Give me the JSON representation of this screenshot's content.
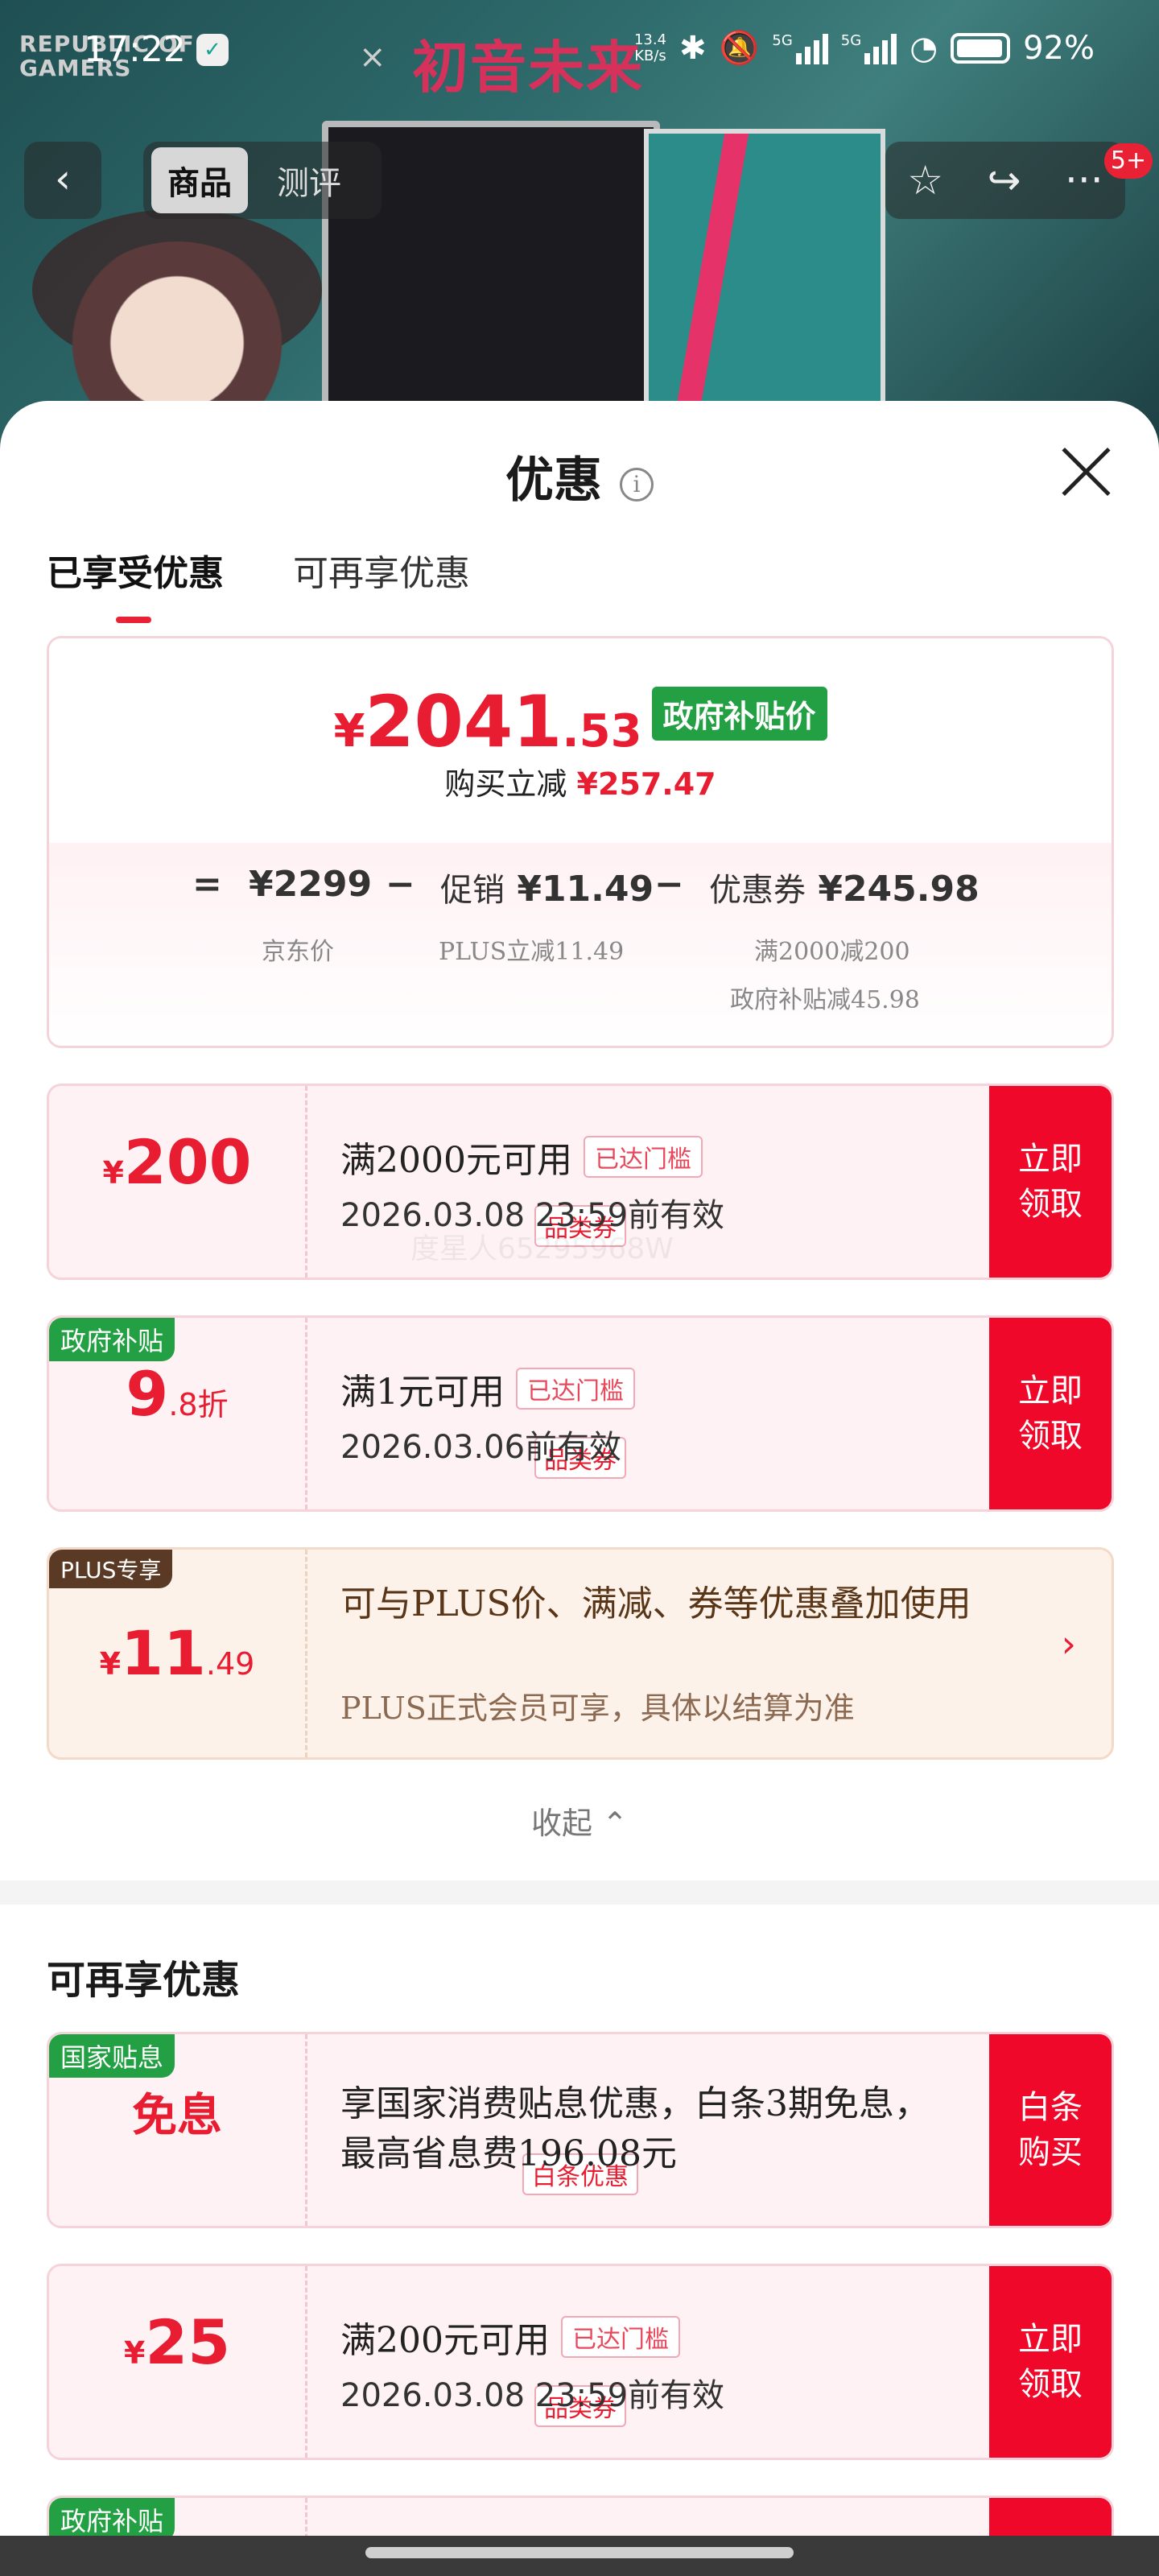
{
  "status_bar": {
    "time": "17:22",
    "net_speed": "13.4\nKB/s",
    "net_speed_value": "13.4",
    "net_speed_unit": "KB/s",
    "signal1": "5G",
    "signal2": "5G",
    "battery": "92%"
  },
  "banner": {
    "brand_left": "REPUBLIC OF\nGAMERS",
    "brand_line1": "REPUBLIC OF",
    "brand_line2": "GAMERS",
    "brand_x": "×",
    "brand_right": "初音未来"
  },
  "nav": {
    "back": "‹",
    "tabs": [
      {
        "label": "商品",
        "active": true
      },
      {
        "label": "测评",
        "active": false
      }
    ],
    "star": "☆",
    "share": "↪",
    "more": "···",
    "badge": "5+"
  },
  "sheet": {
    "title": "优惠",
    "info": "i",
    "tabs": [
      {
        "label": "已享受优惠",
        "active": true
      },
      {
        "label": "可再享优惠",
        "active": false
      }
    ]
  },
  "summary": {
    "yen": "¥",
    "price_int": "2041",
    "price_dec": ".53",
    "gov_tag": "政府补贴价",
    "reduce_label": "购买立减",
    "reduce_value": "¥257.47",
    "equals": "=",
    "jd_price": "¥2299",
    "minus": "−",
    "promo_label": "促销",
    "promo_value": "¥11.49",
    "coupon_label": "优惠券",
    "coupon_value": "¥245.98",
    "jd_sub": "京东价",
    "promo_sub": "PLUS立减11.49",
    "coupon_sub1": "满2000减200",
    "coupon_sub2": "政府补贴减45.98"
  },
  "coupons": [
    {
      "yen": "¥",
      "big": "200",
      "small": "",
      "kind": "品类券",
      "condition": "满2000元可用",
      "tag": "已达门槛",
      "valid": "2026.03.08 23:59前有效",
      "action_line1": "立即",
      "action_line2": "领取"
    },
    {
      "corner": "政府补贴",
      "big": "9",
      "small": ".8折",
      "kind": "品类券",
      "condition": "满1元可用",
      "tag": "已达门槛",
      "valid": "2026.03.06前有效",
      "action_line1": "立即",
      "action_line2": "领取"
    }
  ],
  "plus": {
    "corner": "PLUS专享",
    "yen": "¥",
    "big": "11",
    "small": ".49",
    "desc1": "可与PLUS价、满减、券等优惠叠加使用",
    "desc2": "PLUS正式会员可享，具体以结算为准",
    "chevron": "›"
  },
  "collapse_label": "收起 ⌃",
  "watermark": "度星人65295968W",
  "more_section": {
    "title": "可再享优惠",
    "free": {
      "corner": "国家贴息",
      "big": "免息",
      "kind": "白条优惠",
      "desc": "享国家消费贴息优惠，白条3期免息，最高省息费196.08元",
      "action_line1": "白条",
      "action_line2": "购买"
    },
    "coupon": {
      "yen": "¥",
      "big": "25",
      "kind": "品类券",
      "condition": "满200元可用",
      "tag": "已达门槛",
      "valid": "2026.03.08 23:59前有效",
      "action_line1": "立即",
      "action_line2": "领取"
    },
    "next_corner": "政府补贴"
  },
  "colors": {
    "accent_red": "#e81d31",
    "action_red": "#f0082a",
    "gov_green": "#23a043",
    "plus_brown": "#5a3a24"
  }
}
